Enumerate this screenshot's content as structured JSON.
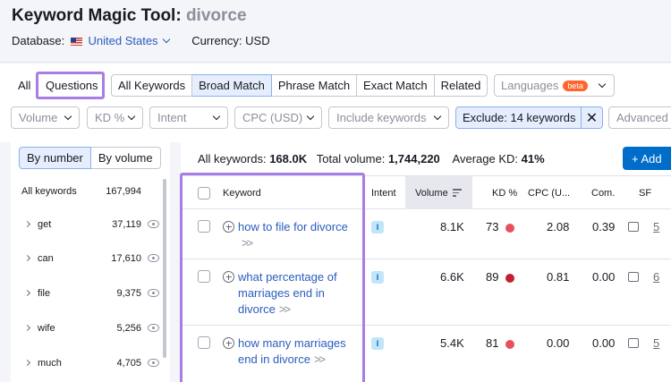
{
  "header": {
    "title": "Keyword Magic Tool:",
    "query": "divorce",
    "database_label": "Database:",
    "database_value": "United States",
    "currency": "Currency: USD"
  },
  "tabs": {
    "all": "All",
    "questions": "Questions",
    "match": [
      "All Keywords",
      "Broad Match",
      "Phrase Match",
      "Exact Match",
      "Related"
    ],
    "languages": "Languages",
    "beta": "beta"
  },
  "filters": {
    "volume": "Volume",
    "kd": "KD %",
    "intent": "Intent",
    "cpc": "CPC (USD)",
    "include": "Include keywords",
    "exclude": "Exclude: 14 keywords",
    "advanced": "Advanced"
  },
  "left_panel": {
    "by_number": "By number",
    "by_volume": "By volume",
    "all_label": "All keywords",
    "all_count": "167,994",
    "groups": [
      {
        "label": "get",
        "count": "37,119"
      },
      {
        "label": "can",
        "count": "17,610"
      },
      {
        "label": "file",
        "count": "9,375"
      },
      {
        "label": "wife",
        "count": "5,256"
      },
      {
        "label": "much",
        "count": "4,705"
      }
    ]
  },
  "summary": {
    "all_label": "All keywords:",
    "all_value": "168.0K",
    "vol_label": "Total volume:",
    "vol_value": "1,744,220",
    "kd_label": "Average KD:",
    "kd_value": "41%",
    "add_label": "+ Add"
  },
  "table": {
    "headers": {
      "keyword": "Keyword",
      "intent": "Intent",
      "volume": "Volume",
      "kd": "KD %",
      "cpc": "CPC (U...",
      "com": "Com.",
      "sf": "SF"
    },
    "rows": [
      {
        "keyword": "how to file for divorce",
        "intent": "I",
        "volume": "8.1K",
        "kd": "73",
        "kd_color": "#e8505b",
        "cpc": "2.08",
        "com": "0.39",
        "sf": "5"
      },
      {
        "keyword": "what percentage of marriages end in divorce",
        "intent": "I",
        "volume": "6.6K",
        "kd": "89",
        "kd_color": "#c41f2e",
        "cpc": "0.81",
        "com": "0.00",
        "sf": "6"
      },
      {
        "keyword": "how many marriages end in divorce",
        "intent": "I",
        "volume": "5.4K",
        "kd": "81",
        "kd_color": "#e8505b",
        "cpc": "0.00",
        "com": "0.00",
        "sf": "5"
      }
    ]
  },
  "colors": {
    "accent": "#2a5cbf",
    "highlight": "#a77de8",
    "primary_button": "#006dca"
  }
}
